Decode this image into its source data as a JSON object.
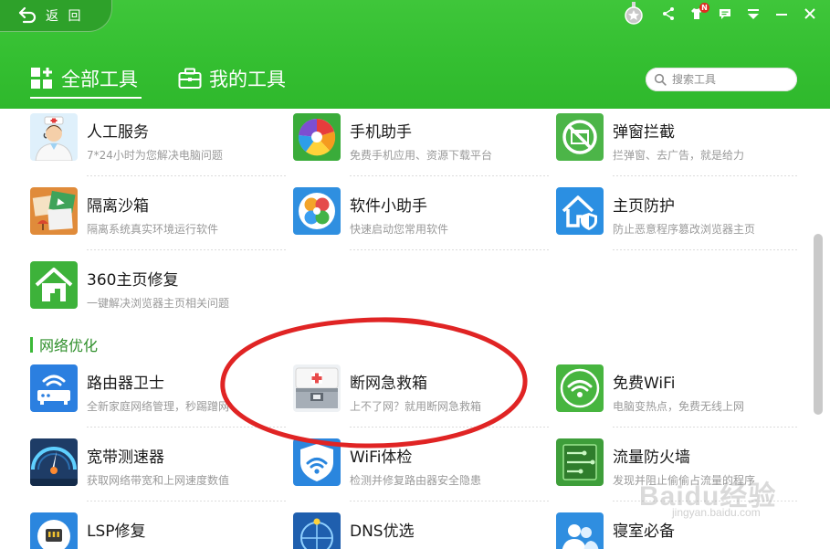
{
  "header": {
    "back_label": "返 回",
    "tabs": [
      {
        "label": "全部工具",
        "active": true
      },
      {
        "label": "我的工具",
        "active": false
      }
    ],
    "search_placeholder": "搜索工具",
    "notification_badge": "N"
  },
  "tools_group_top": [
    {
      "name": "人工服务",
      "desc": "7*24小时为您解决电脑问题",
      "icon": "customer-service-icon"
    },
    {
      "name": "手机助手",
      "desc": "免费手机应用、资源下载平台",
      "icon": "phone-assistant-icon"
    },
    {
      "name": "弹窗拦截",
      "desc": "拦弹窗、去广告，就是给力",
      "icon": "popup-block-icon"
    },
    {
      "name": "隔离沙箱",
      "desc": "隔离系统真实环境运行软件",
      "icon": "sandbox-icon"
    },
    {
      "name": "软件小助手",
      "desc": "快速启动您常用软件",
      "icon": "software-helper-icon"
    },
    {
      "name": "主页防护",
      "desc": "防止恶意程序篡改浏览器主页",
      "icon": "homepage-protect-icon"
    },
    {
      "name": "360主页修复",
      "desc": "一键解决浏览器主页相关问题",
      "icon": "homepage-repair-icon"
    }
  ],
  "section": {
    "title": "网络优化"
  },
  "tools_network": [
    {
      "name": "路由器卫士",
      "desc": "全新家庭网络管理，秒踢蹭网",
      "icon": "router-guard-icon"
    },
    {
      "name": "断网急救箱",
      "desc": "上不了网？就用断网急救箱",
      "icon": "network-first-aid-icon"
    },
    {
      "name": "免费WiFi",
      "desc": "电脑变热点，免费无线上网",
      "icon": "free-wifi-icon"
    },
    {
      "name": "宽带测速器",
      "desc": "获取网络带宽和上网速度数值",
      "icon": "speed-test-icon"
    },
    {
      "name": "WiFi体检",
      "desc": "检测并修复路由器安全隐患",
      "icon": "wifi-check-icon"
    },
    {
      "name": "流量防火墙",
      "desc": "发现并阻止偷偷占流量的程序",
      "icon": "traffic-firewall-icon"
    },
    {
      "name": "LSP修复",
      "desc": "",
      "icon": "lsp-repair-icon"
    },
    {
      "name": "DNS优选",
      "desc": "",
      "icon": "dns-optimize-icon"
    },
    {
      "name": "寝室必备",
      "desc": "",
      "icon": "dorm-essentials-icon"
    }
  ],
  "watermark": {
    "main": "Baidu经验",
    "sub": "jingyan.baidu.com"
  },
  "colors": {
    "header_green": "#34bf31",
    "back_green": "#2ea12a",
    "section_green": "#2f8f2b",
    "annotation_red": "#e02424"
  }
}
